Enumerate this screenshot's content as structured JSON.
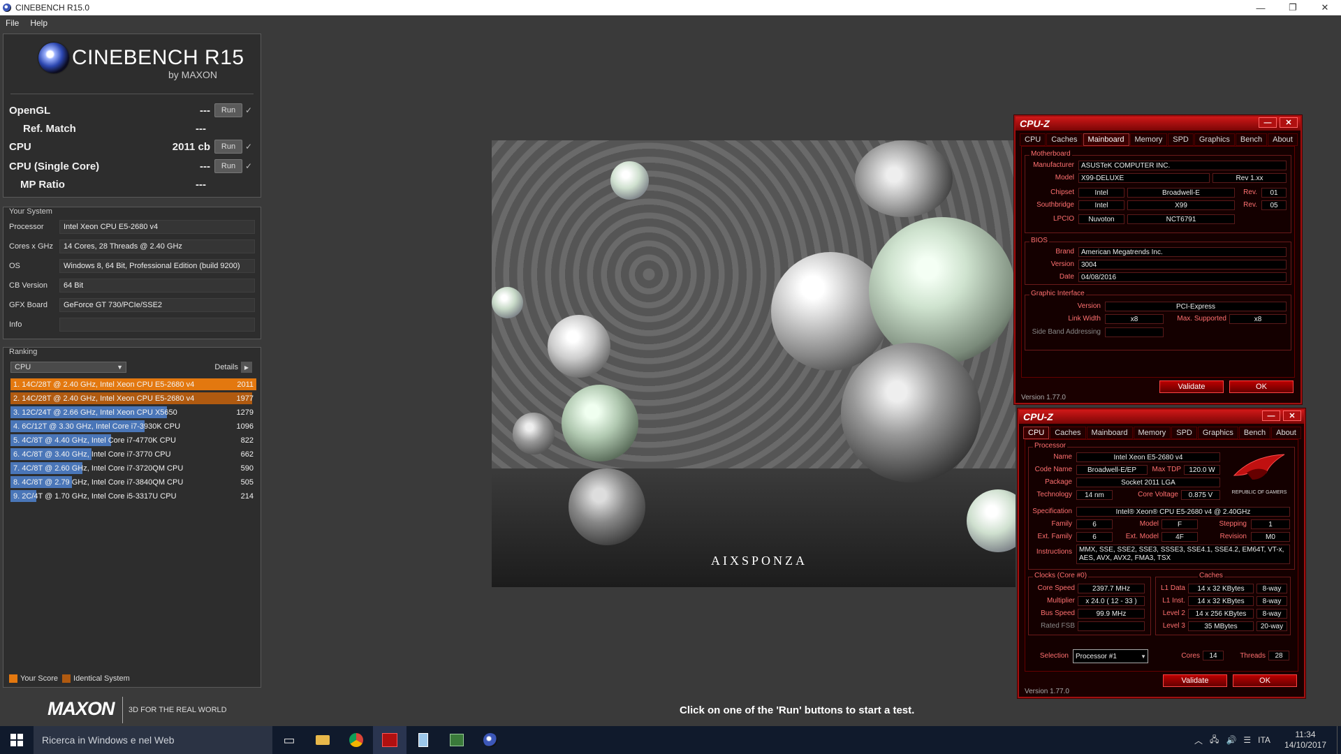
{
  "window": {
    "title": "CINEBENCH R15.0",
    "min": "—",
    "restore": "❐",
    "close": "✕"
  },
  "menu": [
    "File",
    "Help"
  ],
  "logo": {
    "name": "CINEBENCH R15",
    "by": "by MAXON"
  },
  "tests": [
    {
      "label": "OpenGL",
      "value": "---",
      "run": "Run",
      "check": "✓"
    },
    {
      "label": "Ref. Match",
      "value": "---"
    },
    {
      "label": "CPU",
      "value": "2011 cb",
      "run": "Run",
      "check": "✓"
    },
    {
      "label": "CPU (Single Core)",
      "value": "---",
      "run": "Run",
      "check": "✓"
    },
    {
      "label": "MP Ratio",
      "value": "---"
    }
  ],
  "system": {
    "title": "Your System",
    "rows": [
      {
        "k": "Processor",
        "v": "Intel Xeon CPU E5-2680 v4"
      },
      {
        "k": "Cores x GHz",
        "v": "14 Cores, 28 Threads @ 2.40 GHz"
      },
      {
        "k": "OS",
        "v": "Windows 8, 64 Bit, Professional Edition (build 9200)"
      },
      {
        "k": "CB Version",
        "v": "64 Bit"
      },
      {
        "k": "GFX Board",
        "v": "GeForce GT 730/PCIe/SSE2"
      },
      {
        "k": "Info",
        "v": ""
      }
    ]
  },
  "ranking": {
    "title": "Ranking",
    "select": "CPU",
    "details": "Details",
    "rows": [
      {
        "text": "1. 14C/28T @ 2.40 GHz, Intel Xeon CPU E5-2680 v4",
        "score": "2011",
        "fill": 1.0,
        "color": "#e3780f"
      },
      {
        "text": "2. 14C/28T @ 2.40 GHz, Intel Xeon CPU E5-2680 v4",
        "score": "1977",
        "fill": 0.983,
        "color": "#b05a10"
      },
      {
        "text": "3. 12C/24T @ 2.66 GHz, Intel Xeon CPU X5650",
        "score": "1279",
        "fill": 0.636,
        "color": "#4a76b8"
      },
      {
        "text": "4. 6C/12T @ 3.30 GHz,  Intel Core i7-3930K CPU",
        "score": "1096",
        "fill": 0.545,
        "color": "#4a76b8"
      },
      {
        "text": "5. 4C/8T @ 4.40 GHz, Intel Core i7-4770K CPU",
        "score": "822",
        "fill": 0.409,
        "color": "#4a76b8"
      },
      {
        "text": "6. 4C/8T @ 3.40 GHz,  Intel Core i7-3770 CPU",
        "score": "662",
        "fill": 0.329,
        "color": "#4a76b8"
      },
      {
        "text": "7. 4C/8T @ 2.60 GHz, Intel Core i7-3720QM CPU",
        "score": "590",
        "fill": 0.293,
        "color": "#4a76b8"
      },
      {
        "text": "8. 4C/8T @ 2.79 GHz,  Intel Core i7-3840QM CPU",
        "score": "505",
        "fill": 0.251,
        "color": "#4a76b8"
      },
      {
        "text": "9. 2C/4T @ 1.70 GHz,  Intel Core i5-3317U CPU",
        "score": "214",
        "fill": 0.106,
        "color": "#4a76b8"
      }
    ],
    "legend": [
      {
        "label": "Your Score",
        "color": "#e3780f"
      },
      {
        "label": "Identical System",
        "color": "#b05a10"
      }
    ]
  },
  "footer": {
    "brand": "MAXON",
    "tagline": "3D FOR THE REAL WORLD",
    "status": "Click on one of the 'Run' buttons to start a test."
  },
  "render": {
    "watermark": "AIXSPONZA"
  },
  "cpuz_mb": {
    "title": "CPU-Z",
    "tabs": [
      "CPU",
      "Caches",
      "Mainboard",
      "Memory",
      "SPD",
      "Graphics",
      "Bench",
      "About"
    ],
    "active_tab": "Mainboard",
    "motherboard": {
      "title": "Motherboard",
      "manufacturer_label": "Manufacturer",
      "manufacturer": "ASUSTeK COMPUTER INC.",
      "model_label": "Model",
      "model": "X99-DELUXE",
      "model_rev": "Rev 1.xx",
      "chipset_label": "Chipset",
      "chipset_vendor": "Intel",
      "chipset": "Broadwell-E",
      "chipset_rev_label": "Rev.",
      "chipset_rev": "01",
      "south_label": "Southbridge",
      "south_vendor": "Intel",
      "south": "X99",
      "south_rev_label": "Rev.",
      "south_rev": "05",
      "lpcio_label": "LPCIO",
      "lpcio_vendor": "Nuvoton",
      "lpcio": "NCT6791"
    },
    "bios": {
      "title": "BIOS",
      "brand_label": "Brand",
      "brand": "American Megatrends Inc.",
      "version_label": "Version",
      "version": "3004",
      "date_label": "Date",
      "date": "04/08/2016"
    },
    "graphic": {
      "title": "Graphic Interface",
      "version_label": "Version",
      "version": "PCI-Express",
      "link_label": "Link Width",
      "link": "x8",
      "max_label": "Max. Supported",
      "max": "x8",
      "sba_label": "Side Band Addressing"
    },
    "validate": "Validate",
    "ok": "OK",
    "version": "Version 1.77.0"
  },
  "cpuz_cpu": {
    "title": "CPU-Z",
    "tabs": [
      "CPU",
      "Caches",
      "Mainboard",
      "Memory",
      "SPD",
      "Graphics",
      "Bench",
      "About"
    ],
    "active_tab": "CPU",
    "processor": {
      "title": "Processor",
      "name_label": "Name",
      "name": "Intel Xeon E5-2680 v4",
      "code_label": "Code Name",
      "code": "Broadwell-E/EP",
      "tdp_label": "Max TDP",
      "tdp": "120.0 W",
      "package_label": "Package",
      "package": "Socket 2011 LGA",
      "tech_label": "Technology",
      "tech": "14 nm",
      "volt_label": "Core Voltage",
      "volt": "0.875 V",
      "spec_label": "Specification",
      "spec": "Intel® Xeon® CPU E5-2680 v4 @ 2.40GHz",
      "family_label": "Family",
      "family": "6",
      "model_label": "Model",
      "model": "F",
      "stepping_label": "Stepping",
      "stepping": "1",
      "extfam_label": "Ext. Family",
      "extfam": "6",
      "extmod_label": "Ext. Model",
      "extmod": "4F",
      "rev_label": "Revision",
      "rev": "M0",
      "instr_label": "Instructions",
      "instr1": "MMX, SSE, SSE2, SSE3, SSSE3, SSE4.1, SSE4.2, EM64T, VT-x,",
      "instr2": "AES, AVX, AVX2, FMA3, TSX",
      "rog_text": "REPUBLIC OF GAMERS"
    },
    "clocks": {
      "title": "Clocks (Core #0)",
      "core_label": "Core Speed",
      "core": "2397.7 MHz",
      "mult_label": "Multiplier",
      "mult": "x 24.0 ( 12 - 33 )",
      "bus_label": "Bus Speed",
      "bus": "99.9 MHz",
      "fsb_label": "Rated FSB"
    },
    "caches": {
      "title": "Caches",
      "l1d_label": "L1 Data",
      "l1d": "14 x 32 KBytes",
      "l1d_way": "8-way",
      "l1i_label": "L1 Inst.",
      "l1i": "14 x 32 KBytes",
      "l1i_way": "8-way",
      "l2_label": "Level 2",
      "l2": "14 x 256 KBytes",
      "l2_way": "8-way",
      "l3_label": "Level 3",
      "l3": "35 MBytes",
      "l3_way": "20-way"
    },
    "selection_label": "Selection",
    "selection": "Processor #1",
    "cores_label": "Cores",
    "cores": "14",
    "threads_label": "Threads",
    "threads": "28",
    "validate": "Validate",
    "ok": "OK",
    "version": "Version 1.77.0"
  },
  "taskbar": {
    "search": "Ricerca in Windows e nel Web",
    "lang": "ITA",
    "time": "11:34",
    "date": "14/10/2017"
  }
}
